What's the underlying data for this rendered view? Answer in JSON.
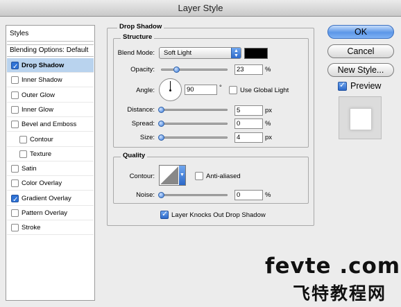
{
  "window": {
    "title": "Layer Style"
  },
  "sidebar": {
    "header": "Styles",
    "blending_options": "Blending Options: Default",
    "items": [
      {
        "label": "Drop Shadow",
        "checked": true,
        "selected": true,
        "indent": false
      },
      {
        "label": "Inner Shadow",
        "checked": false,
        "selected": false,
        "indent": false
      },
      {
        "label": "Outer Glow",
        "checked": false,
        "selected": false,
        "indent": false
      },
      {
        "label": "Inner Glow",
        "checked": false,
        "selected": false,
        "indent": false
      },
      {
        "label": "Bevel and Emboss",
        "checked": false,
        "selected": false,
        "indent": false
      },
      {
        "label": "Contour",
        "checked": false,
        "selected": false,
        "indent": true
      },
      {
        "label": "Texture",
        "checked": false,
        "selected": false,
        "indent": true
      },
      {
        "label": "Satin",
        "checked": false,
        "selected": false,
        "indent": false
      },
      {
        "label": "Color Overlay",
        "checked": false,
        "selected": false,
        "indent": false
      },
      {
        "label": "Gradient Overlay",
        "checked": true,
        "selected": false,
        "indent": false
      },
      {
        "label": "Pattern Overlay",
        "checked": false,
        "selected": false,
        "indent": false
      },
      {
        "label": "Stroke",
        "checked": false,
        "selected": false,
        "indent": false
      }
    ]
  },
  "drop_shadow": {
    "title": "Drop Shadow",
    "structure": {
      "title": "Structure",
      "blend_mode_label": "Blend Mode:",
      "blend_mode_value": "Soft Light",
      "shadow_color": "#000000",
      "opacity_label": "Opacity:",
      "opacity_value": "23",
      "opacity_unit": "%",
      "opacity_fraction": 0.23,
      "angle_label": "Angle:",
      "angle_value": "90",
      "angle_unit": "°",
      "angle_degrees": 90,
      "use_global_light_label": "Use Global Light",
      "use_global_light_checked": false,
      "distance_label": "Distance:",
      "distance_value": "5",
      "distance_unit": "px",
      "distance_fraction": 0.0,
      "spread_label": "Spread:",
      "spread_value": "0",
      "spread_unit": "%",
      "spread_fraction": 0.0,
      "size_label": "Size:",
      "size_value": "4",
      "size_unit": "px",
      "size_fraction": 0.0
    },
    "quality": {
      "title": "Quality",
      "contour_label": "Contour:",
      "anti_aliased_label": "Anti-aliased",
      "anti_aliased_checked": false,
      "noise_label": "Noise:",
      "noise_value": "0",
      "noise_unit": "%",
      "noise_fraction": 0.0
    },
    "layer_knocks_out_label": "Layer Knocks Out Drop Shadow",
    "layer_knocks_out_checked": true
  },
  "buttons": {
    "ok": "OK",
    "cancel": "Cancel",
    "new_style": "New Style...",
    "preview_label": "Preview",
    "preview_checked": true
  },
  "watermark": {
    "line1": "fevte .com",
    "line2": "飞特教程网"
  },
  "colors": {
    "selection": "#b9d3ee",
    "accent": "#2c69c9"
  }
}
